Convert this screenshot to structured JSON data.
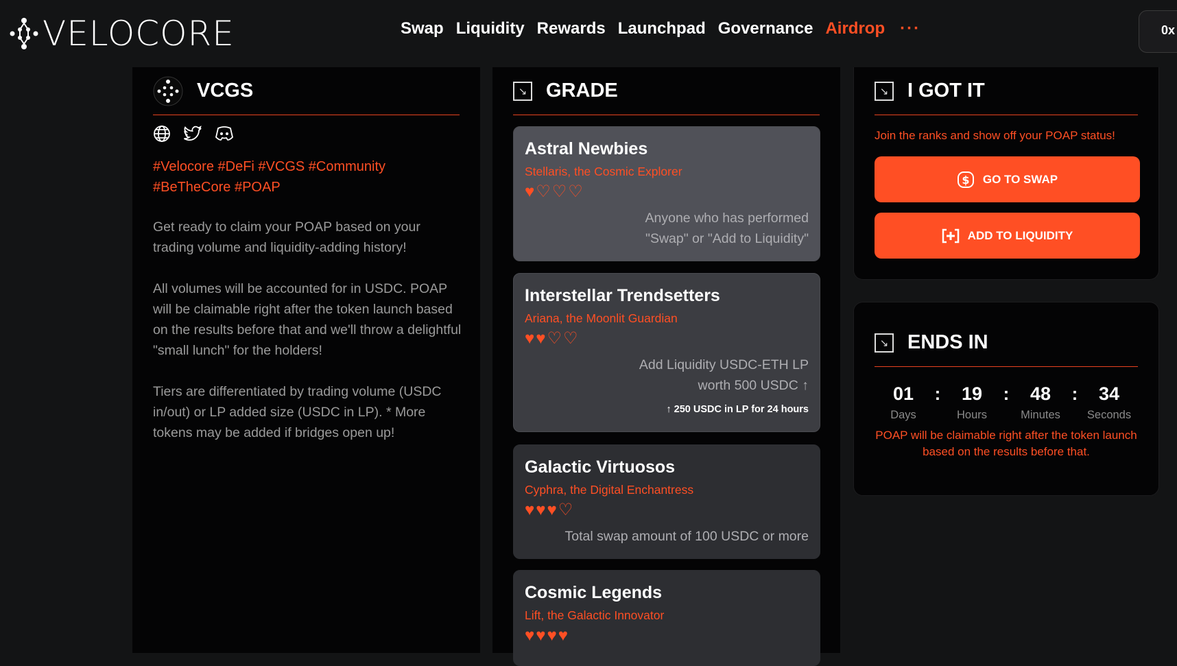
{
  "brand": {
    "name": "VELOCORE"
  },
  "nav": {
    "items": [
      "Swap",
      "Liquidity",
      "Rewards",
      "Launchpad",
      "Governance",
      "Airdrop"
    ],
    "active": "Airdrop",
    "more": "···"
  },
  "wallet": {
    "label": "0x"
  },
  "colors": {
    "accent": "#ff4f24",
    "background": "#131415",
    "panel": "#040405"
  },
  "vcgs": {
    "title": "VCGS",
    "social_icons": [
      "globe-icon",
      "twitter-icon",
      "discord-icon"
    ],
    "tags": "#Velocore #DeFi #VCGS #Community #BeTheCore #POAP",
    "paragraphs": [
      "Get ready to claim your POAP based on your trading volume and liquidity-adding history!",
      "All volumes will be accounted for in USDC. POAP will be claimable right after the token launch based on the results before that and we'll throw a delightful \"small lunch\" for the holders!",
      "Tiers are differentiated by trading volume (USDC in/out) or LP added size (USDC in LP). * More tokens may be added if bridges open up!"
    ]
  },
  "grade": {
    "title": "GRADE",
    "tiers": [
      {
        "name": "Astral Newbies",
        "character": "Stellaris, the Cosmic Explorer",
        "hearts": 1,
        "max_hearts": 4,
        "requirement": "Anyone who has performed \"Swap\" or \"Add to Liquidity\"",
        "note": ""
      },
      {
        "name": "Interstellar Trendsetters",
        "character": "Ariana, the Moonlit Guardian",
        "hearts": 2,
        "max_hearts": 4,
        "requirement": "Add Liquidity USDC-ETH LP worth 500 USDC ↑",
        "note": "↑ 250 USDC in LP for 24 hours"
      },
      {
        "name": "Galactic Virtuosos",
        "character": "Cyphra, the Digital Enchantress",
        "hearts": 3,
        "max_hearts": 4,
        "requirement": "Total swap amount of 100 USDC or more",
        "note": ""
      },
      {
        "name": "Cosmic Legends",
        "character": "Lift, the Galactic Innovator",
        "hearts": 4,
        "max_hearts": 4,
        "requirement": "",
        "note": ""
      }
    ]
  },
  "gotit": {
    "title": "I GOT IT",
    "subtitle": "Join the ranks and show off your POAP status!",
    "swap_label": "GO TO SWAP",
    "liquidity_label": "ADD TO LIQUIDITY"
  },
  "ends": {
    "title": "ENDS IN",
    "days": "01",
    "hours": "19",
    "minutes": "48",
    "seconds": "34",
    "days_label": "Days",
    "hours_label": "Hours",
    "minutes_label": "Minutes",
    "seconds_label": "Seconds",
    "note": "POAP will be claimable right after the token launch based on the results before that."
  }
}
